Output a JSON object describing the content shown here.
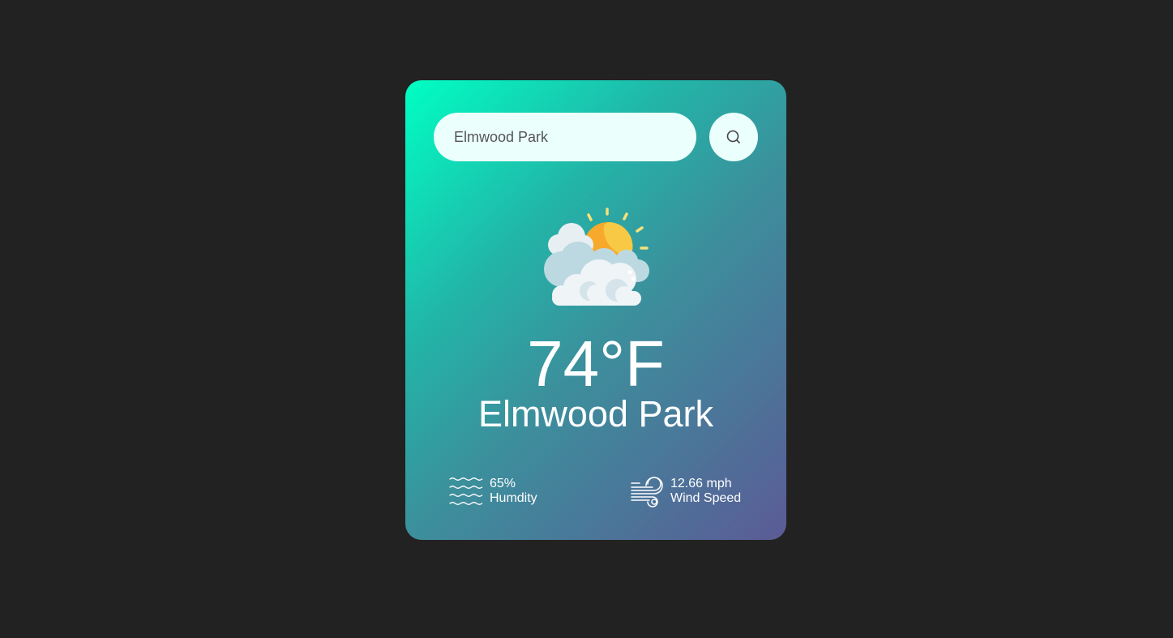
{
  "search": {
    "value": "Elmwood Park",
    "button_icon": "search-icon"
  },
  "weather": {
    "icon": "partly-cloudy-icon",
    "temperature": "74°F",
    "city": "Elmwood Park"
  },
  "details": {
    "humidity": {
      "icon": "humidity-waves-icon",
      "value": "65%",
      "label": "Humdity"
    },
    "wind": {
      "icon": "wind-icon",
      "value": "12.66 mph",
      "label": "Wind Speed"
    }
  },
  "colors": {
    "background": "#222222",
    "card_gradient_start": "#00ffc3",
    "card_gradient_end": "#5b5b96",
    "input_bg": "#ebfffc",
    "text": "#ffffff"
  }
}
